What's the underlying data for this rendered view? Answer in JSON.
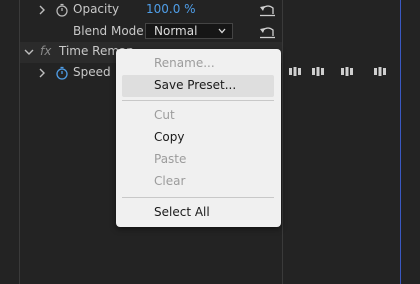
{
  "colors": {
    "panel_bg": "#232323",
    "accent_blue": "#4f9ee8",
    "boundary_blue": "#3a58c2",
    "menu_bg": "#f0f0f0",
    "menu_hover": "#dedede"
  },
  "properties": {
    "opacity": {
      "label": "Opacity",
      "value": "100.0 %",
      "icon": "stopwatch-icon"
    },
    "blend_mode": {
      "label": "Blend Mode",
      "value": "Normal"
    },
    "time_remap": {
      "fx_label": "fx",
      "label": "Time Remap"
    },
    "speed": {
      "label": "Speed",
      "icon": "stopwatch-icon"
    }
  },
  "timeline": {
    "keyframe_count": 4
  },
  "context_menu": {
    "items": [
      {
        "label": "Rename...",
        "enabled": false
      },
      {
        "label": "Save Preset...",
        "enabled": true,
        "highlighted": true
      },
      {
        "label": "Cut",
        "enabled": false
      },
      {
        "label": "Copy",
        "enabled": true
      },
      {
        "label": "Paste",
        "enabled": false
      },
      {
        "label": "Clear",
        "enabled": false
      },
      {
        "label": "Select All",
        "enabled": true
      }
    ]
  }
}
